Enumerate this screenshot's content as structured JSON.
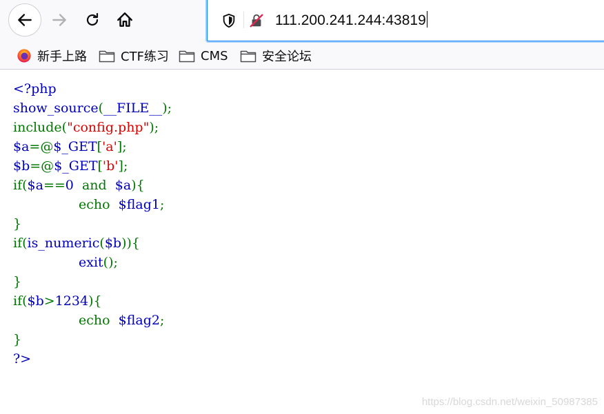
{
  "colors": {
    "default": "#0000BB",
    "keyword": "#007700",
    "string": "#DD0000",
    "accent": "#0a84ff"
  },
  "toolbar": {
    "back_icon": "arrow-left-icon",
    "forward_icon": "arrow-right-icon",
    "reload_icon": "reload-icon",
    "home_icon": "home-icon",
    "url": "111.200.241.244:43819"
  },
  "bookmarks": [
    {
      "label": "新手上路",
      "icon": "firefox-icon"
    },
    {
      "label": "CTF练习",
      "icon": "folder-icon"
    },
    {
      "label": "CMS",
      "icon": "folder-icon"
    },
    {
      "label": "安全论坛",
      "icon": "folder-icon"
    }
  ],
  "code": [
    [
      {
        "t": "<?php",
        "c": "default"
      }
    ],
    [
      {
        "t": "show_source",
        "c": "default"
      },
      {
        "t": "(",
        "c": "keyword"
      },
      {
        "t": "__FILE__",
        "c": "default"
      },
      {
        "t": ");",
        "c": "keyword"
      }
    ],
    [
      {
        "t": "include(",
        "c": "keyword"
      },
      {
        "t": "\"config.php\"",
        "c": "string"
      },
      {
        "t": ");",
        "c": "keyword"
      }
    ],
    [
      {
        "t": "$a",
        "c": "default"
      },
      {
        "t": "=@",
        "c": "keyword"
      },
      {
        "t": "$_GET",
        "c": "default"
      },
      {
        "t": "[",
        "c": "keyword"
      },
      {
        "t": "'a'",
        "c": "string"
      },
      {
        "t": "];",
        "c": "keyword"
      }
    ],
    [
      {
        "t": "$b",
        "c": "default"
      },
      {
        "t": "=@",
        "c": "keyword"
      },
      {
        "t": "$_GET",
        "c": "default"
      },
      {
        "t": "[",
        "c": "keyword"
      },
      {
        "t": "'b'",
        "c": "string"
      },
      {
        "t": "];",
        "c": "keyword"
      }
    ],
    [
      {
        "t": "if(",
        "c": "keyword"
      },
      {
        "t": "$a",
        "c": "default"
      },
      {
        "t": "==",
        "c": "keyword"
      },
      {
        "t": "0 ",
        "c": "default"
      },
      {
        "t": " and ",
        "c": "keyword"
      },
      {
        "t": " $a",
        "c": "default"
      },
      {
        "t": "){",
        "c": "keyword"
      }
    ],
    [
      {
        "t": "echo ",
        "c": "keyword"
      },
      {
        "t": " $flag1",
        "c": "default"
      },
      {
        "t": ";",
        "c": "keyword"
      }
    ],
    [
      {
        "t": "}",
        "c": "keyword"
      }
    ],
    [
      {
        "t": "if(",
        "c": "keyword"
      },
      {
        "t": "is_numeric",
        "c": "default"
      },
      {
        "t": "(",
        "c": "keyword"
      },
      {
        "t": "$b",
        "c": "default"
      },
      {
        "t": ")){",
        "c": "keyword"
      }
    ],
    [
      {
        "t": "exit",
        "c": "default"
      },
      {
        "t": "();",
        "c": "keyword"
      }
    ],
    [
      {
        "t": "}",
        "c": "keyword"
      }
    ],
    [
      {
        "t": "if(",
        "c": "keyword"
      },
      {
        "t": "$b",
        "c": "default"
      },
      {
        "t": ">",
        "c": "keyword"
      },
      {
        "t": "1234",
        "c": "default"
      },
      {
        "t": "){",
        "c": "keyword"
      }
    ],
    [
      {
        "t": "echo ",
        "c": "keyword"
      },
      {
        "t": " $flag2",
        "c": "default"
      },
      {
        "t": ";",
        "c": "keyword"
      }
    ],
    [
      {
        "t": "}",
        "c": "keyword"
      }
    ],
    [
      {
        "t": "?>",
        "c": "default"
      }
    ]
  ],
  "watermark": "https://blog.csdn.net/weixin_50987385"
}
